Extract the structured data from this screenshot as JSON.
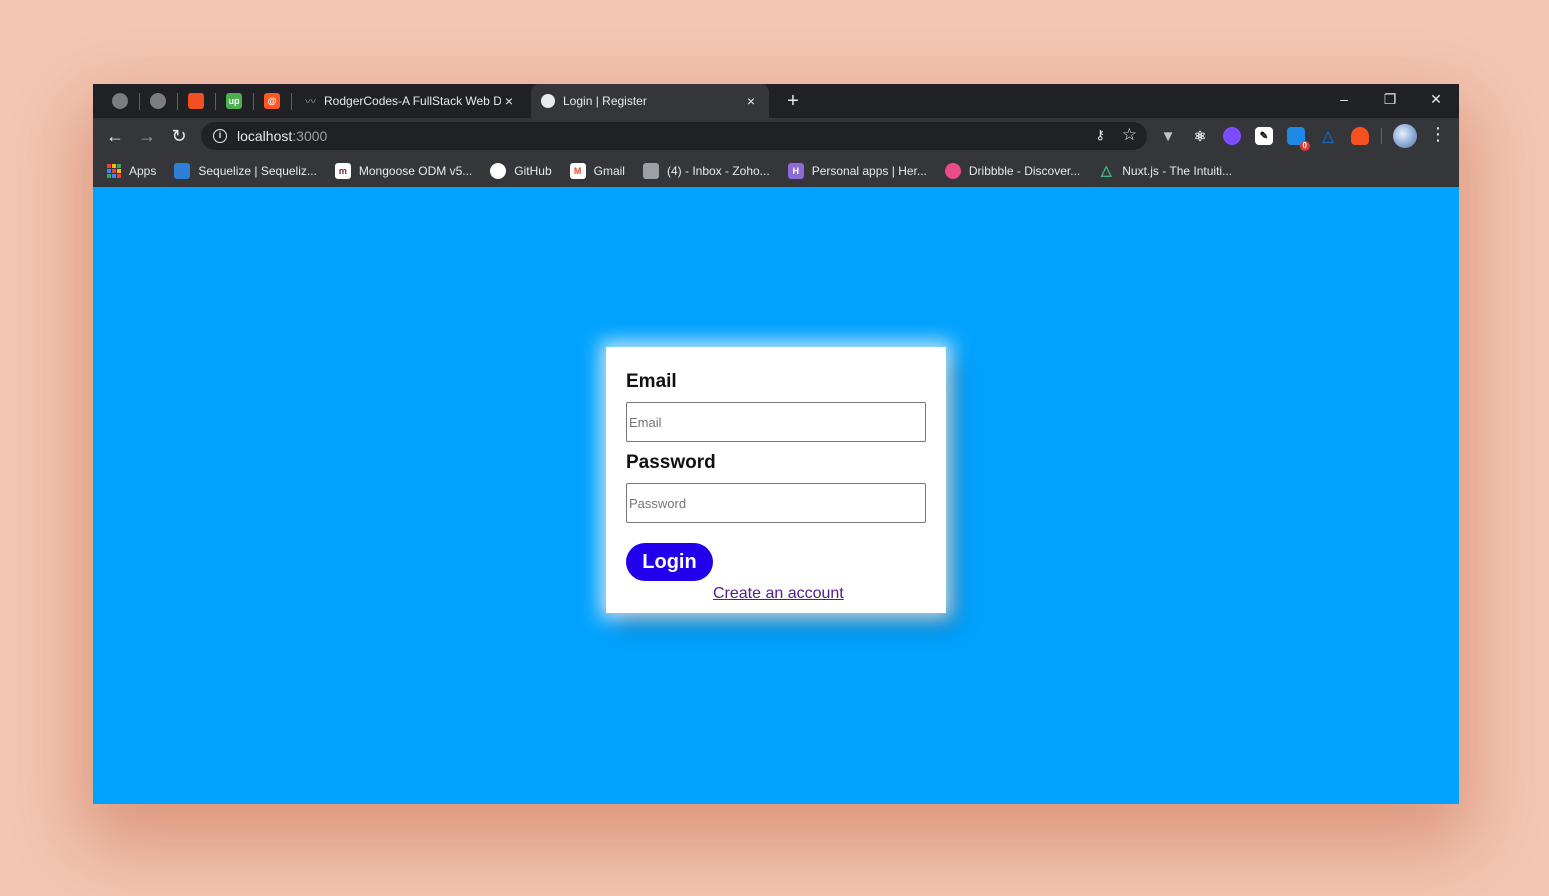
{
  "tabs": {
    "pinned": [
      {
        "name": "pinned-tab-1",
        "color": "#7a7d82",
        "glyph": ""
      },
      {
        "name": "pinned-tab-2",
        "color": "#7a7d82",
        "glyph": ""
      },
      {
        "name": "pinned-tab-3",
        "color": "#f25022",
        "glyph": ""
      },
      {
        "name": "pinned-tab-4",
        "color": "#4caf50",
        "glyph": "up"
      },
      {
        "name": "pinned-tab-5",
        "color": "#ff5722",
        "glyph": "@"
      }
    ],
    "items": [
      {
        "title": "RodgerCodes-A FullStack Web De",
        "close": "×",
        "active": false
      },
      {
        "title": "Login | Register",
        "close": "×",
        "active": true
      }
    ],
    "new_tab": "+"
  },
  "window_controls": {
    "minimize": "–",
    "restore": "❐",
    "close": "✕"
  },
  "toolbar": {
    "back": "←",
    "forward": "→",
    "reload": "↻",
    "url_host": "localhost",
    "url_port": ":3000",
    "info_glyph": "i",
    "key_glyph": "🔑",
    "star_glyph": "☆",
    "menu_glyph": "⋮",
    "extension_badge": "0"
  },
  "bookmarks": [
    {
      "label": "Apps",
      "icon": "apps-grid-icon"
    },
    {
      "label": "Sequelize | Sequeliz...",
      "icon": "sequelize-icon",
      "color": "#2f7fd8"
    },
    {
      "label": "Mongoose ODM v5...",
      "icon": "mongoose-icon",
      "color": "#ffffff"
    },
    {
      "label": "GitHub",
      "icon": "github-icon",
      "color": "#ffffff"
    },
    {
      "label": "Gmail",
      "icon": "gmail-icon",
      "color": "#ea4335"
    },
    {
      "label": "(4) - Inbox - Zoho...",
      "icon": "zoho-icon",
      "color": "#9aa0a6"
    },
    {
      "label": "Personal apps | Her...",
      "icon": "heroku-icon",
      "color": "#8a6bd6"
    },
    {
      "label": "Dribbble - Discover...",
      "icon": "dribbble-icon",
      "color": "#ea4c89"
    },
    {
      "label": "Nuxt.js - The Intuiti...",
      "icon": "nuxt-icon",
      "color": "#41b883"
    }
  ],
  "form": {
    "email_label": "Email",
    "email_placeholder": "Email",
    "email_value": "",
    "password_label": "Password",
    "password_placeholder": "Password",
    "password_value": "",
    "login_button": "Login",
    "create_account_link": "Create an account"
  },
  "colors": {
    "page_background": "#00a2ff",
    "login_button": "#2200ee",
    "link": "#551a8b",
    "desktop_background": "#f3c6b4"
  }
}
